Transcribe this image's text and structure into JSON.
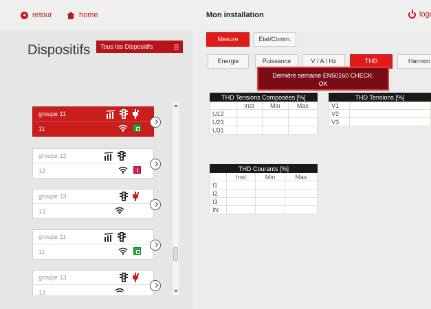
{
  "topbar": {
    "back_label": "retour",
    "home_label": "home",
    "title": "Mon installation",
    "logout_label": "logo"
  },
  "left": {
    "title": "Dispositifs",
    "filter_select": "Tous les Dispositifs",
    "devices": [
      {
        "group": "groupe 11",
        "id": "11",
        "status": "green",
        "active": true
      },
      {
        "group": "groupe 12",
        "id": "12",
        "status": "red",
        "active": false
      },
      {
        "group": "groupe 13",
        "id": "13",
        "status": "none",
        "active": false
      },
      {
        "group": "groupe 11",
        "id": "11",
        "status": "green",
        "active": false
      },
      {
        "group": "groupe 13",
        "id": "13",
        "status": "none",
        "active": false
      }
    ]
  },
  "tabs_top": [
    "Mesure",
    "État/Comm."
  ],
  "tabs_sub": [
    "Energie",
    "Puissance",
    "V / A / Hz",
    "THD",
    "Harmon"
  ],
  "tooltip": {
    "line1": "Dernière semaine EN50160 CHECK:",
    "line2": "OK"
  },
  "tables": {
    "thd_tensions_composees": {
      "title": "THD Tensions Composées [%]",
      "columns": [
        "",
        "Inst",
        "Min",
        "Max"
      ],
      "rows": [
        "U12",
        "U23",
        "U31"
      ]
    },
    "thd_tensions": {
      "title": "THD Tensions [%]",
      "rows": [
        "V1",
        "V2",
        "V3"
      ]
    },
    "thd_courants": {
      "title": "THD Courants [%]",
      "columns": [
        "",
        "Inst",
        "Min",
        "Max"
      ],
      "rows": [
        "I1",
        "I2",
        "I3",
        "IN"
      ]
    }
  },
  "colors": {
    "accent": "#c21a1a",
    "button_red": "#e01b1b",
    "tooltip_bg": "#7a0c16",
    "status_green": "#27a83a",
    "status_red": "#d2234a"
  }
}
